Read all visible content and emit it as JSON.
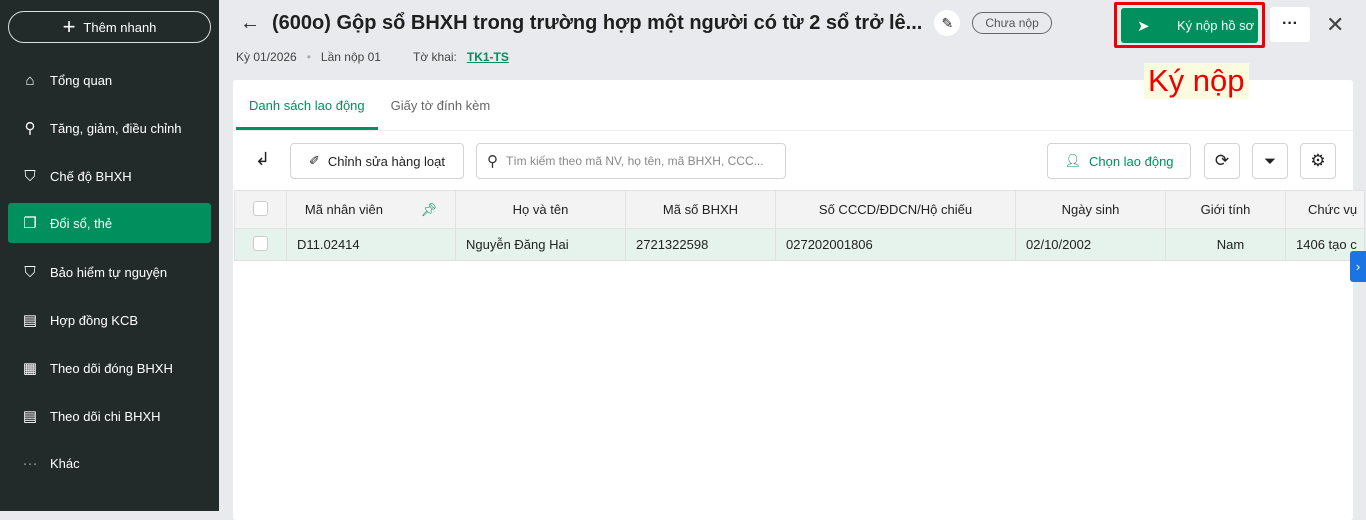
{
  "sidebar": {
    "quick_add": "Thêm nhanh",
    "items": [
      {
        "label": "Tổng quan",
        "icon": "home-icon"
      },
      {
        "label": "Tăng, giảm, điều chỉnh",
        "icon": "user-up-icon"
      },
      {
        "label": "Chế độ BHXH",
        "icon": "shield-heart-icon"
      },
      {
        "label": "Đổi sổ, thẻ",
        "icon": "copy-icon"
      },
      {
        "label": "Bảo hiểm tự nguyện",
        "icon": "shield-icon"
      },
      {
        "label": "Hợp đồng KCB",
        "icon": "scroll-icon"
      },
      {
        "label": "Theo dõi đóng BHXH",
        "icon": "c12-doc-icon"
      },
      {
        "label": "Theo dõi chi BHXH",
        "icon": "doc-icon"
      },
      {
        "label": "Khác",
        "icon": "more-icon"
      }
    ]
  },
  "header": {
    "title": "(600o) Gộp sổ BHXH trong trường hợp một người có từ 2 sổ trở lê...",
    "status": "Chưa nộp",
    "period": "Kỳ 01/2026",
    "submission": "Lần nộp 01",
    "form_label": "Tờ khai:",
    "form_code": "TK1-TS",
    "sign_button": "Ký nộp hồ sơ",
    "annotation": "Ký nộp"
  },
  "tabs": [
    "Danh sách lao động",
    "Giấy tờ đính kèm"
  ],
  "toolbar": {
    "bulk_edit": "Chỉnh sửa hàng loạt",
    "search_placeholder": "Tìm kiếm theo mã NV, họ tên, mã BHXH, CCC...",
    "choose_employee": "Chọn lao động"
  },
  "table": {
    "columns": [
      "Mã nhân viên",
      "Họ và tên",
      "Mã số BHXH",
      "Số CCCD/ĐDCN/Hộ chiếu",
      "Ngày sinh",
      "Giới tính",
      "Chức vụ"
    ],
    "rows": [
      [
        "D11.02414",
        "Nguyễn Đăng Hai",
        "2721322598",
        "027202001806",
        "02/10/2002",
        "Nam",
        "1406 tạo c"
      ]
    ]
  },
  "colors": {
    "accent": "#008f5d",
    "sidebar": "#232b2a"
  }
}
